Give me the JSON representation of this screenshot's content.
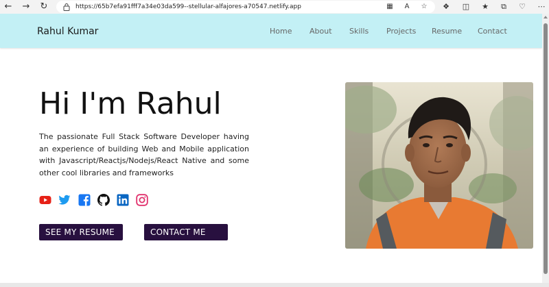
{
  "browser": {
    "url": "https://65b7efa91fff7a34e03da599--stellular-alfajores-a70547.netlify.app"
  },
  "site": {
    "brand": "Rahul Kumar",
    "nav": [
      {
        "label": "Home"
      },
      {
        "label": "About"
      },
      {
        "label": "Skills"
      },
      {
        "label": "Projects"
      },
      {
        "label": "Resume"
      },
      {
        "label": "Contact"
      }
    ]
  },
  "hero": {
    "title": "Hi I'm Rahul",
    "description": "The passionate Full Stack Software Developer having an experience of building Web and Mobile application with Javascript/Reactjs/Nodejs/React Native and some other cool libraries and frameworks",
    "socials": [
      {
        "icon": "youtube-icon",
        "color": "#e62117"
      },
      {
        "icon": "twitter-icon",
        "color": "#1d9bf0"
      },
      {
        "icon": "facebook-icon",
        "color": "#1877f2"
      },
      {
        "icon": "github-icon",
        "color": "#111111"
      },
      {
        "icon": "linkedin-icon",
        "color": "#0a66c2"
      },
      {
        "icon": "instagram-icon",
        "color": "#e1306c"
      }
    ],
    "resume_button": "SEE MY RESUME",
    "contact_button": "CONTACT ME"
  },
  "colors": {
    "navbar_bg": "#c3f0f5",
    "button_bg": "#28103f",
    "button_text": "#ffffff"
  }
}
